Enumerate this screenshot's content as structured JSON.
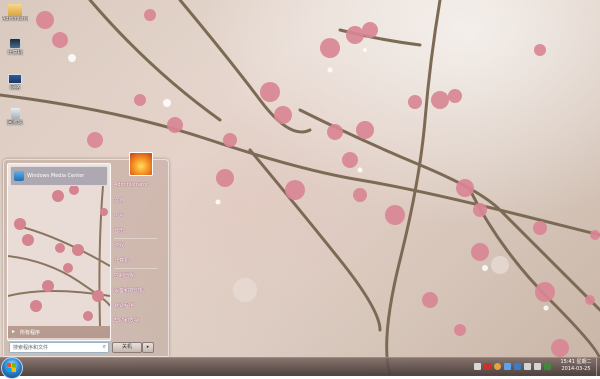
{
  "desktop": {
    "icons": [
      {
        "label": "Administrator",
        "icon": "user-folder-icon"
      },
      {
        "label": "计算机",
        "icon": "computer-icon"
      },
      {
        "label": "网络",
        "icon": "network-icon"
      },
      {
        "label": "回收站",
        "icon": "recycle-bin-icon"
      }
    ]
  },
  "start_menu": {
    "pinned_item": {
      "label": "Windows Media Center",
      "icon": "media-center-icon"
    },
    "all_programs": "所有程序",
    "search_placeholder": "搜索程序和文件",
    "right_items": [
      {
        "label": "Administrator"
      },
      {
        "label": "文档"
      },
      {
        "label": "图片"
      },
      {
        "label": "音乐"
      },
      {
        "label": "游戏"
      },
      {
        "label": "计算机"
      },
      {
        "label": "控制面板"
      },
      {
        "label": "设备和打印机"
      },
      {
        "label": "默认程序"
      },
      {
        "label": "帮助和支持"
      }
    ],
    "shutdown_label": "关机",
    "shutdown_more": "▸"
  },
  "taskbar": {
    "time": "15:41 星期二",
    "date": "2014-03-25"
  },
  "colors": {
    "taskbar": "#4a3d3b",
    "orb": "#2b86d1",
    "blossom": "#d98794"
  }
}
